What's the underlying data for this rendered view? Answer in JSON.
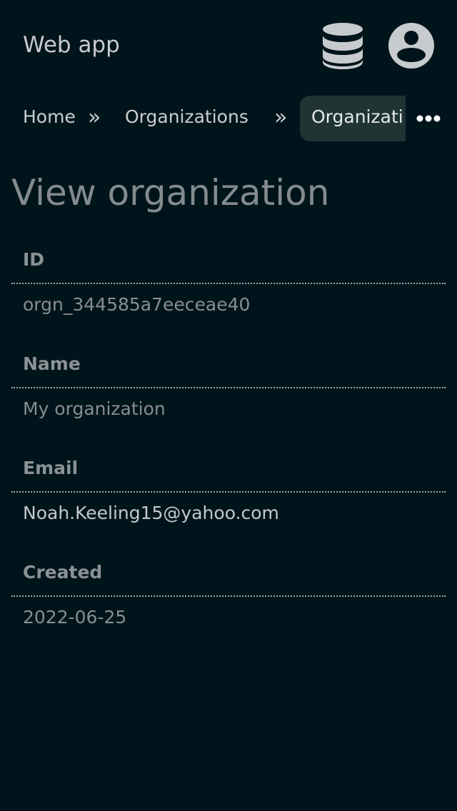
{
  "header": {
    "app_title": "Web app",
    "icons": [
      "database-icon",
      "user-account-icon"
    ]
  },
  "breadcrumb": {
    "items": [
      {
        "label": "Home"
      },
      {
        "label": "Organizations"
      },
      {
        "label": "Organizati"
      }
    ],
    "separator": "»",
    "more_icon": "ellipsis-icon"
  },
  "page": {
    "title": "View organization"
  },
  "fields": [
    {
      "label": "ID",
      "value": "orgn_344585a7eeceae40"
    },
    {
      "label": "Name",
      "value": "My organization"
    },
    {
      "label": "Email",
      "value": "Noah.Keeling15@yahoo.com"
    },
    {
      "label": "Created",
      "value": "2022-06-25"
    }
  ],
  "colors": {
    "background": "#00141b",
    "active_crumb_bg": "#1f3433",
    "icon": "#c7cbcd"
  }
}
